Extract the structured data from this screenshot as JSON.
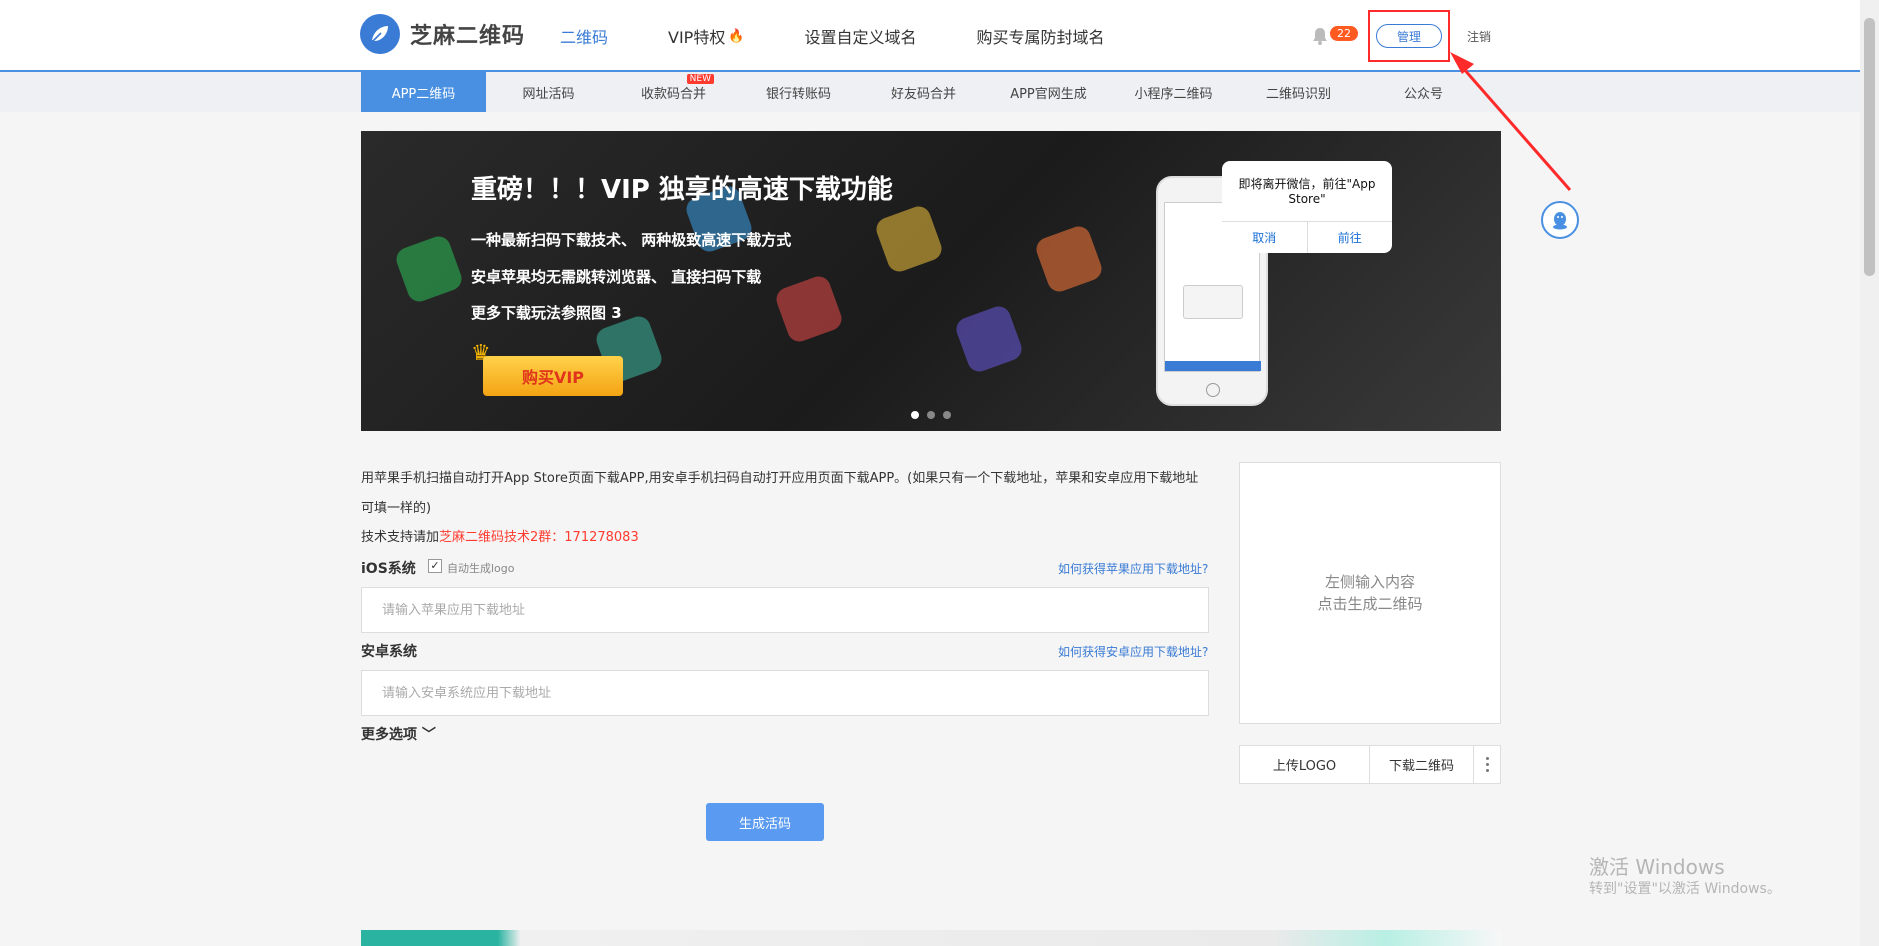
{
  "header": {
    "logo_text": "芝麻二维码",
    "nav": [
      {
        "label": "二维码",
        "active": true
      },
      {
        "label": "VIP特权",
        "hot": true
      },
      {
        "label": "设置自定义域名"
      },
      {
        "label": "购买专属防封域名"
      }
    ],
    "notification_count": "22",
    "manage_label": "管理",
    "logout_label": "注销"
  },
  "subtabs": [
    {
      "label": "APP二维码",
      "active": true
    },
    {
      "label": "网址活码"
    },
    {
      "label": "收款码合并",
      "new": "NEW"
    },
    {
      "label": "银行转账码"
    },
    {
      "label": "好友码合并"
    },
    {
      "label": "APP官网生成"
    },
    {
      "label": "小程序二维码"
    },
    {
      "label": "二维码识别"
    },
    {
      "label": "公众号"
    }
  ],
  "banner": {
    "title": "重磅！！！VIP 独享的高速下载功能",
    "lines": [
      "一种最新扫码下载技术、 两种极致高速下载方式",
      "安卓苹果均无需跳转浏览器、 直接扫码下载",
      "更多下载玩法参照图 3"
    ],
    "buy_label": "购买VIP",
    "dialog_title": "即将离开微信，前往\"App Store\"",
    "dialog_cancel": "取消",
    "dialog_go": "前往"
  },
  "form": {
    "description": "用苹果手机扫描自动打开App Store页面下载APP,用安卓手机扫码自动打开应用页面下载APP。(如果只有一个下载地址，苹果和安卓应用下载地址可填一样的)",
    "support_prefix": "技术支持请加",
    "support_group": "芝麻二维码技术2群：171278083",
    "ios_label": "iOS系统",
    "auto_logo_label": "自动生成logo",
    "ios_help": "如何获得苹果应用下载地址?",
    "ios_placeholder": "请输入苹果应用下载地址",
    "android_label": "安卓系统",
    "android_help": "如何获得安卓应用下载地址?",
    "android_placeholder": "请输入安卓系统应用下载地址",
    "more_options": "更多选项",
    "generate_label": "生成活码"
  },
  "qr": {
    "hint_line1": "左侧输入内容",
    "hint_line2": "点击生成二维码",
    "upload_logo": "上传LOGO",
    "download_qr": "下载二维码"
  },
  "watermark": {
    "line1": "激活 Windows",
    "line2": "转到\"设置\"以激活 Windows。"
  },
  "colors": {
    "primary": "#4a90e2",
    "accent_red": "#ff3b30",
    "annotation": "#ff2a2a"
  }
}
